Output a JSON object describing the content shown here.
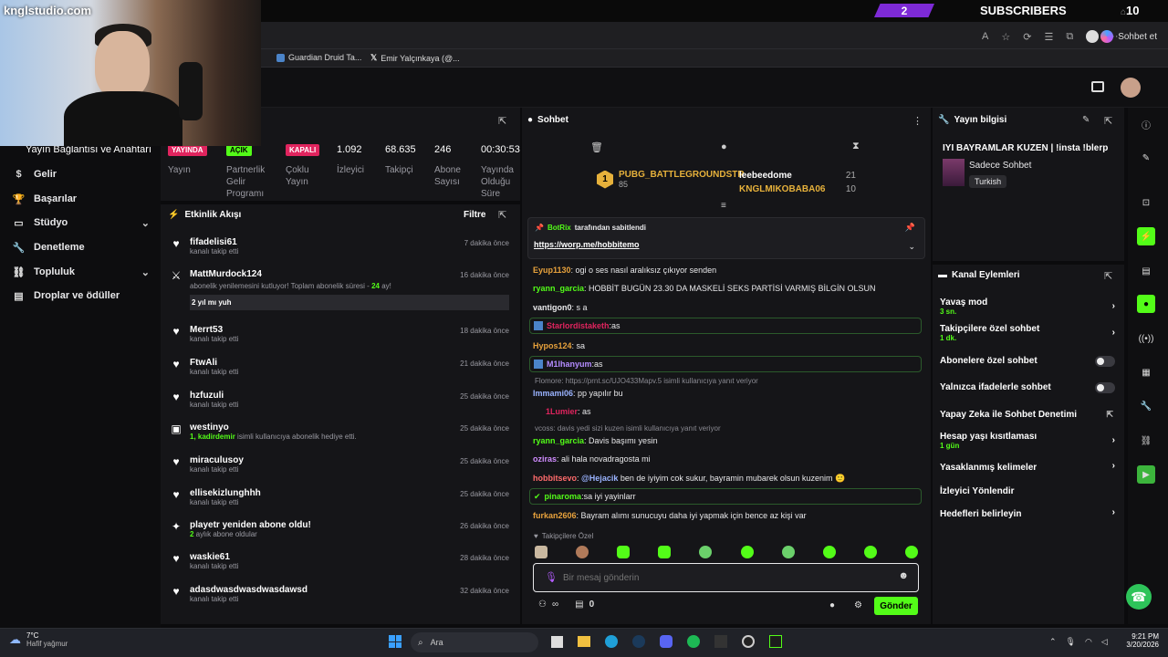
{
  "site_title": "knglstudio.com",
  "promo": {
    "sub_goal": "2",
    "label": "SUBSCRIBERS",
    "total": "10"
  },
  "bookmarks": [
    "Guardian Druid Ta...",
    "Emir Yalçınkaya (@..."
  ],
  "browser": {
    "chat_button": "Sohbet et"
  },
  "sidebar": {
    "top_label": "Yayın Bağlantısı ve Anahtarı",
    "items": [
      {
        "label": "Gelir",
        "icon": "dollar-icon"
      },
      {
        "label": "Başarılar",
        "icon": "trophy-icon"
      },
      {
        "label": "Stüdyo",
        "icon": "video-icon",
        "expandable": true
      },
      {
        "label": "Denetleme",
        "icon": "wrench-icon"
      },
      {
        "label": "Topluluk",
        "icon": "link-icon",
        "expandable": true
      },
      {
        "label": "Droplar ve ödüller",
        "icon": "gift-icon"
      }
    ]
  },
  "stats": {
    "live": {
      "badge": "YAYINDA",
      "label": "Yayın"
    },
    "partner": {
      "badge": "AÇIK",
      "label": "Partnerlik Gelir Programı"
    },
    "multi": {
      "badge": "KAPALI",
      "label": "Çoklu Yayın"
    },
    "viewers": {
      "value": "1.092",
      "label": "İzleyici"
    },
    "followers": {
      "value": "68.635",
      "label": "Takipçi"
    },
    "subs": {
      "value": "246",
      "label": "Abone Sayısı"
    },
    "uptime": {
      "value": "00:30:53",
      "label": "Yayında Olduğu Süre"
    }
  },
  "feed": {
    "title": "Etkinlik Akışı",
    "filter": "Filtre",
    "items": [
      {
        "name": "fifadelisi61",
        "sub": "kanalı takip etti",
        "time": "7 dakika önce",
        "icon": "heart-icon"
      },
      {
        "name": "MattMurdock124",
        "sub": "abonelik yenilemesini kutluyor! Toplam abonelik süresi - ",
        "sub_highlight": "24",
        "sub_tail": " ay!",
        "message": "2 yıl mı yuh",
        "time": "16 dakika önce",
        "icon": "crossed-swords-icon"
      },
      {
        "name": "Merrt53",
        "sub": "kanalı takip etti",
        "time": "18 dakika önce",
        "icon": "heart-icon"
      },
      {
        "name": "FtwAli",
        "sub": "kanalı takip etti",
        "time": "21 dakika önce",
        "icon": "heart-icon"
      },
      {
        "name": "hzfuzuli",
        "sub": "kanalı takip etti",
        "time": "25 dakika önce",
        "icon": "heart-icon"
      },
      {
        "name": "westinyo",
        "sub_highlight": "1, kadirdemir",
        "sub": " isimli kullanıcıya abonelik hediye etti.",
        "time": "25 dakika önce",
        "icon": "gift-icon"
      },
      {
        "name": "miraculusoy",
        "sub": "kanalı takip etti",
        "time": "25 dakika önce",
        "icon": "heart-icon"
      },
      {
        "name": "ellisekizlunghhh",
        "sub": "kanalı takip etti",
        "time": "25 dakika önce",
        "icon": "heart-icon"
      },
      {
        "name": "playetr yeniden abone oldu!",
        "sub_highlight": "2",
        "sub": " aylık abone oldular",
        "time": "26 dakika önce",
        "icon": "sparkle-icon"
      },
      {
        "name": "waskie61",
        "sub": "kanalı takip etti",
        "time": "28 dakika önce",
        "icon": "heart-icon"
      },
      {
        "name": "adasdwasdwasdwasdawsd",
        "sub": "kanalı takip etti",
        "time": "32 dakika önce",
        "icon": "heart-icon"
      }
    ]
  },
  "chat": {
    "title": "Sohbet",
    "leaderboard": {
      "top": {
        "name": "PUBG_BATTLEGROUNDSTR",
        "score": "85",
        "rank": "1"
      },
      "others": [
        {
          "name": "leebeedome",
          "score": "21"
        },
        {
          "name": "KNGLMIKOBABA06",
          "score": "10"
        }
      ]
    },
    "pinned": {
      "by": "BotRix",
      "suffix": "tarafından sabitlendi",
      "link": "https://worp.me/hobbitemo"
    },
    "messages": [
      {
        "user": "Eyup1130",
        "color": "#e8a23c",
        "text": "ogi o ses nasıl aralıksız çıkıyor senden"
      },
      {
        "user": "ryann_garcia",
        "color": "#53fc18",
        "text": "HOBBİT BUGÜN 23.30 DA MASKELİ SEKS PARTİSİ VARMIŞ BİLGİN OLSUN"
      },
      {
        "user": "vantigon0",
        "color": "#e8e8ea",
        "text": "s a"
      },
      {
        "user": "Starlordistaketh",
        "color": "#e0245e",
        "text": "as",
        "highlight": true
      },
      {
        "user": "Hypos124",
        "color": "#e8a23c",
        "text": "sa"
      },
      {
        "user": "M1lhanyum",
        "color": "#b48cff",
        "text": "as",
        "highlight": true
      },
      {
        "reply_to": "Flomore: https://prnt.sc/UJO433Mapv.5 isimli kullanıcıya yanıt veriyor",
        "user": "Immami06",
        "color": "#9ab3ff",
        "text": "pp yapılır bu"
      },
      {
        "user": "1Lumier",
        "color": "#e0245e",
        "text": "as"
      },
      {
        "reply_to": "vcoss: davis yedi sizi kuzen isimli kullanıcıya yanıt veriyor",
        "user": "ryann_garcia",
        "color": "#53fc18",
        "text": "Davis başımı yesin"
      },
      {
        "user": "oziras",
        "color": "#d08cff",
        "text": "ali hala novadragosta mi"
      },
      {
        "user": "hobbitsevo",
        "color": "#ff6b6b",
        "mention": "@Hejacik",
        "text": " ben de iyiyim cok sukur, bayramin mubarek olsun kuzenim 🙂"
      },
      {
        "user": "pinaroma",
        "color": "#53fc18",
        "text": "sa iyi yayinlarr",
        "highlight": true
      },
      {
        "user": "furkan2606",
        "color": "#e8a23c",
        "text": "Bayram alımı sunucuyu daha iyi yapmak için bence az kişi var"
      }
    ],
    "followers_only": "Takipçilere Özel",
    "input_placeholder": "Bir mesaj gönderin",
    "points": "0",
    "send": "Gönder"
  },
  "stream_info": {
    "title": "Yayın bilgisi",
    "stream_title": "IYI BAYRAMLAR KUZEN | !insta !blerp",
    "category": "Sadece Sohbet",
    "language": "Turkish"
  },
  "channel_actions": {
    "title": "Kanal Eylemleri",
    "items": [
      {
        "label": "Yavaş mod",
        "sub": "3 sn.",
        "type": "chevron"
      },
      {
        "label": "Takipçilere özel sohbet",
        "sub": "1 dk.",
        "type": "chevron"
      },
      {
        "label": "Abonelere özel sohbet",
        "type": "toggle"
      },
      {
        "label": "Yalnızca ifadelerle sohbet",
        "type": "toggle"
      },
      {
        "label": "Yapay Zeka ile Sohbet Denetimi",
        "type": "external"
      },
      {
        "label": "Hesap yaşı kısıtlaması",
        "sub": "1 gün",
        "type": "chevron"
      },
      {
        "label": "Yasaklanmış kelimeler",
        "type": "chevron"
      },
      {
        "label": "İzleyici Yönlendir",
        "type": "none"
      },
      {
        "label": "Hedefleri belirleyin",
        "type": "chevron"
      }
    ]
  },
  "taskbar": {
    "weather_temp": "7°C",
    "weather_desc": "Hafif yağmur",
    "search": "Ara",
    "time": "9:21 PM",
    "date": "3/20/2026"
  },
  "colors": {
    "accent": "#53fc18",
    "live": "#e0245e",
    "bg": "#151518"
  }
}
